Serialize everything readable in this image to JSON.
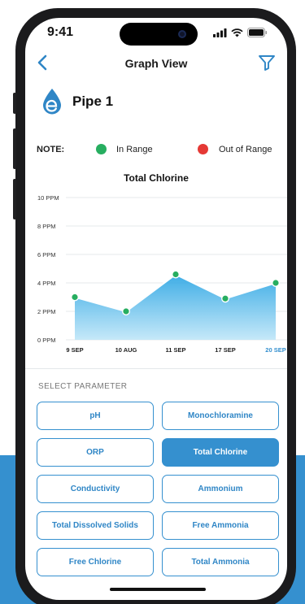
{
  "status": {
    "time": "9:41"
  },
  "header": {
    "title": "Graph View",
    "back_icon": "chevron-left-icon",
    "filter_icon": "filter-icon"
  },
  "pipe": {
    "title": "Pipe 1",
    "logo_icon": "water-drop-logo-icon"
  },
  "legend": {
    "note_label": "NOTE:",
    "items": [
      {
        "label": "In Range",
        "color": "#27ae60"
      },
      {
        "label": "Out of Range",
        "color": "#e53935"
      }
    ]
  },
  "chart_data": {
    "type": "area",
    "title": "Total Chlorine",
    "categories": [
      "9 SEP",
      "10 AUG",
      "11 SEP",
      "17 SEP",
      "20 SEP"
    ],
    "values": [
      3.0,
      2.0,
      4.6,
      2.9,
      4.0
    ],
    "y_ticks": [
      "0 PPM",
      "2 PPM",
      "4 PPM",
      "6 PPM",
      "8 PPM",
      "10 PPM"
    ],
    "ylim": [
      0,
      10
    ],
    "point_color": "#27ae60",
    "highlight_category": "20 SEP",
    "grid": true
  },
  "parameters": {
    "section_label": "SELECT PARAMETER",
    "selected": "Total Chlorine",
    "items": [
      "pH",
      "Monochloramine",
      "ORP",
      "Total Chlorine",
      "Conductivity",
      "Ammonium",
      "Total Dissolved Solids",
      "Free Ammonia",
      "Free Chlorine",
      "Total Ammonia"
    ]
  },
  "colors": {
    "accent": "#3590cf",
    "background_band": "#3590cf"
  }
}
